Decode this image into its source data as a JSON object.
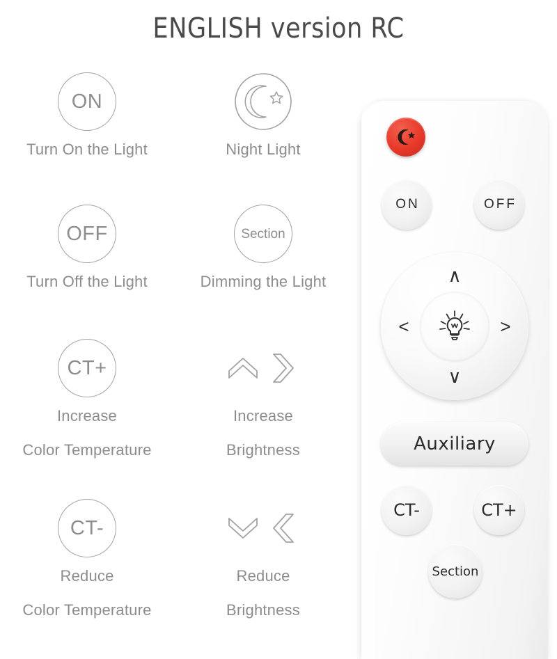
{
  "page": {
    "title": "ENGLISH version RC",
    "title_color": "#4a4a4a",
    "background_color": "#ffffff",
    "legend_text_color": "#8c8c8c",
    "accent_red": "#e8392a"
  },
  "legend": [
    {
      "icon_kind": "circle-text",
      "icon_name": "on-circle-icon",
      "icon_text": "ON",
      "label_line1": "Turn On the Light",
      "label_line2": ""
    },
    {
      "icon_kind": "circle-moon-star",
      "icon_name": "night-light-circle-icon",
      "icon_text": "",
      "label_line1": "Night Light",
      "label_line2": ""
    },
    {
      "icon_kind": "circle-text",
      "icon_name": "off-circle-icon",
      "icon_text": "OFF",
      "label_line1": "Turn Off the Light",
      "label_line2": ""
    },
    {
      "icon_kind": "circle-text-small",
      "icon_name": "section-circle-icon",
      "icon_text": "Section",
      "label_line1": "Dimming the Light",
      "label_line2": ""
    },
    {
      "icon_kind": "circle-text",
      "icon_name": "ct-plus-circle-icon",
      "icon_text": "CT+",
      "label_line1": "Increase",
      "label_line2": "Color Temperature"
    },
    {
      "icon_kind": "chevrons-up-right",
      "icon_name": "increase-brightness-chevrons-icon",
      "icon_text": "",
      "label_line1": "Increase",
      "label_line2": "Brightness"
    },
    {
      "icon_kind": "circle-text",
      "icon_name": "ct-minus-circle-icon",
      "icon_text": "CT-",
      "label_line1": "Reduce",
      "label_line2": "Color Temperature"
    },
    {
      "icon_kind": "chevrons-down-left",
      "icon_name": "reduce-brightness-chevrons-icon",
      "icon_text": "",
      "label_line1": "Reduce",
      "label_line2": "Brightness"
    }
  ],
  "remote": {
    "night_button_icon": "moon-star-icon",
    "on_label": "ON",
    "off_label": "OFF",
    "dpad": {
      "up": "∧",
      "down": "∨",
      "left": "<",
      "right": ">",
      "center_icon": "light-bulb-icon"
    },
    "auxiliary_label": "Auxiliary",
    "ct_minus_label": "CT-",
    "ct_plus_label": "CT+",
    "section_label": "Section"
  }
}
